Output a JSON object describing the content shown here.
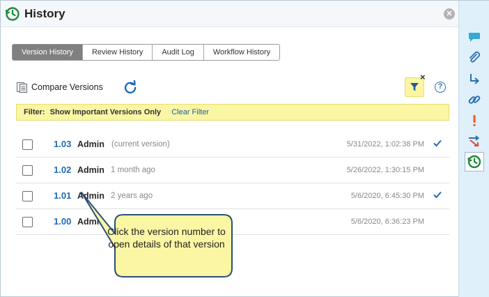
{
  "panel": {
    "title": "History",
    "close_label": "✕"
  },
  "tabs": [
    {
      "label": "Version History",
      "active": true
    },
    {
      "label": "Review History",
      "active": false
    },
    {
      "label": "Audit Log",
      "active": false
    },
    {
      "label": "Workflow History",
      "active": false
    }
  ],
  "toolbar": {
    "compare_label": "Compare Versions",
    "refresh_icon": "refresh-icon",
    "filter_icon": "filter-icon",
    "filter_clear_x": "×",
    "help_label": "?"
  },
  "filter": {
    "label": "Filter:",
    "value": "Show Important Versions Only",
    "clear_label": "Clear Filter"
  },
  "versions": [
    {
      "number": "1.03",
      "user": "Admin",
      "note": "(current version)",
      "date": "5/31/2022, 1:02:38 PM",
      "important": true
    },
    {
      "number": "1.02",
      "user": "Admin",
      "note": "1 month ago",
      "date": "5/26/2022, 1:30:15 PM",
      "important": false
    },
    {
      "number": "1.01",
      "user": "Admin",
      "note": "2 years ago",
      "date": "5/6/2020, 6:45:30 PM",
      "important": true
    },
    {
      "number": "1.00",
      "user": "Admin",
      "note": "",
      "date": "5/6/2020, 6:36:23 PM",
      "important": false
    }
  ],
  "callout": {
    "text": "Click the version number to open details of that version"
  },
  "rail": [
    {
      "icon": "comment-icon"
    },
    {
      "icon": "attachment-icon"
    },
    {
      "icon": "redirect-arrow-icon"
    },
    {
      "icon": "link-icon"
    },
    {
      "icon": "important-icon"
    },
    {
      "icon": "route-icon"
    },
    {
      "icon": "history-icon",
      "active": true
    }
  ],
  "colors": {
    "accent": "#1e6ab6",
    "filter_bg": "#fbf6a3",
    "rail_bg": "#dff0fb",
    "history_green": "#1f8a3e",
    "callout_bg": "#fbf6a3",
    "callout_border": "#2a4e7a"
  }
}
